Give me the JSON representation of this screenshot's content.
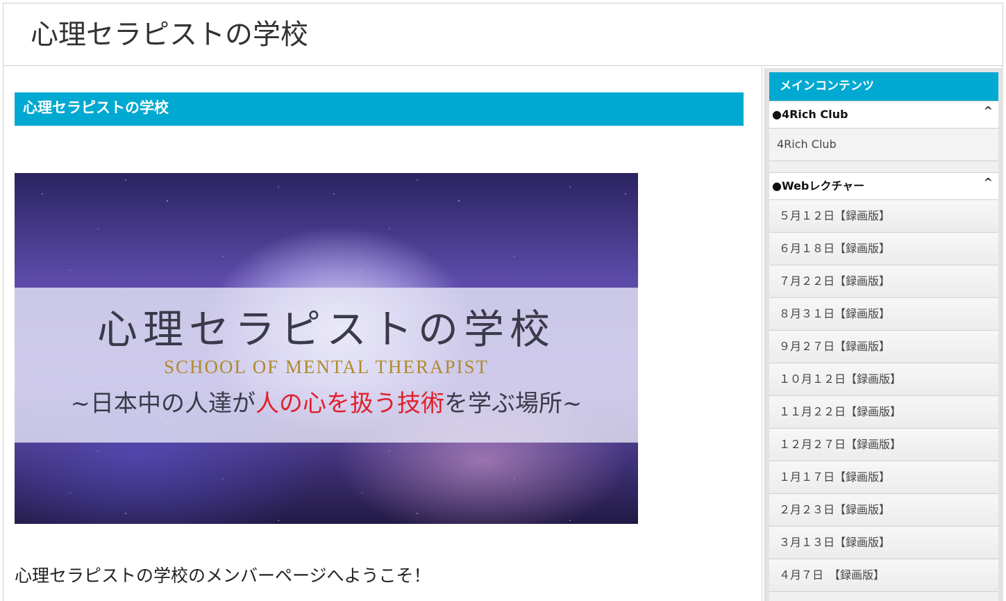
{
  "header": {
    "site_title": "心理セラピストの学校"
  },
  "main": {
    "section_heading": "心理セラピストの学校",
    "banner": {
      "title": "心理セラピストの学校",
      "subtitle": "SCHOOL OF MENTAL THERAPIST",
      "tagline_pre": "~日本中の人達が",
      "tagline_highlight": "人の心を扱う技術",
      "tagline_post": "を学ぶ場所~"
    },
    "welcome_text": "心理セラピストの学校のメンバーページへようこそ！"
  },
  "sidebar": {
    "header": "メインコンテンツ",
    "groups": [
      {
        "label": "●4Rich Club",
        "items": [
          "4Rich Club"
        ]
      },
      {
        "label": "●Webレクチャー",
        "items": [
          "５月１２日【録画版】",
          "６月１８日【録画版】",
          "７月２２日【録画版】",
          "８月３１日【録画版】",
          "９月２７日【録画版】",
          "１０月１２日【録画版】",
          "１１月２２日【録画版】",
          "１２月２７日【録画版】",
          "１月１７日【録画版】",
          "２月２３日【録画版】",
          "３月１３日【録画版】",
          "４月７日　【録画版】"
        ]
      }
    ],
    "chevron_glyph": "^"
  },
  "colors": {
    "accent": "#00a9d1",
    "highlight_red": "#e0202c",
    "gold": "#b08a2c"
  }
}
